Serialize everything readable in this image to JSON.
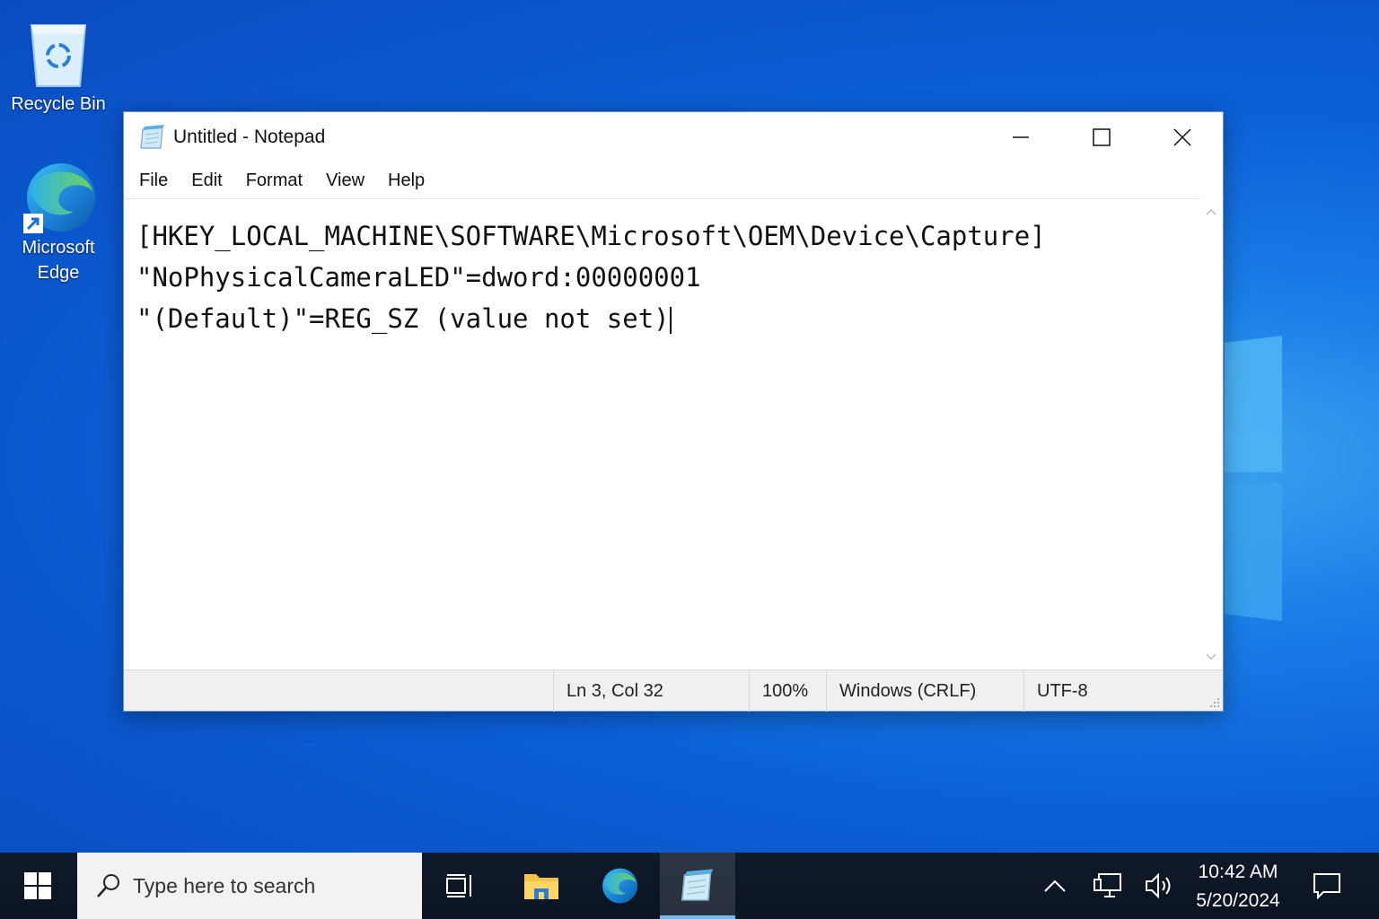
{
  "desktop": {
    "icons": [
      {
        "label": "Recycle Bin",
        "icon": "recycle-bin-icon"
      },
      {
        "label": "Microsoft\nEdge",
        "line1": "Microsoft",
        "line2": "Edge",
        "icon": "edge-icon"
      }
    ]
  },
  "window": {
    "title": "Untitled - Notepad",
    "icon": "notepad-icon",
    "controls": [
      "minimize-icon",
      "maximize-icon",
      "close-icon"
    ],
    "menu": [
      "File",
      "Edit",
      "Format",
      "View",
      "Help"
    ],
    "content_lines": [
      "[HKEY_LOCAL_MACHINE\\SOFTWARE\\Microsoft\\OEM\\Device\\Capture]",
      "\"NoPhysicalCameraLED\"=dword:00000001",
      "\"(Default)\"=REG_SZ (value not set)"
    ],
    "status": {
      "position": "Ln 3, Col 32",
      "zoom": "100%",
      "line_endings": "Windows (CRLF)",
      "encoding": "UTF-8"
    }
  },
  "taskbar": {
    "search_placeholder": "Type here to search",
    "apps": [
      "task-view-icon",
      "file-explorer-icon",
      "edge-icon",
      "notepad-icon"
    ],
    "active_app": "notepad-icon",
    "tray": [
      "chevron-up-icon",
      "network-icon",
      "volume-icon"
    ],
    "time": "10:42 AM",
    "date": "5/20/2024",
    "notification": "action-center-icon"
  },
  "colors": {
    "desktop_blue": "#0b5fd6",
    "taskbar": "#0f1a2a",
    "active_indicator": "#76b9ed"
  }
}
